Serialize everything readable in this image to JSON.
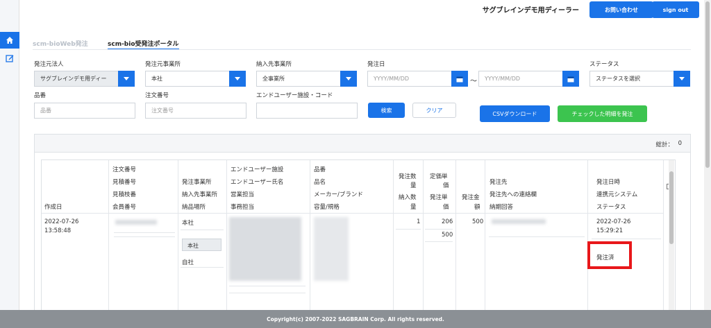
{
  "header": {
    "dealer_name": "サグブレインデモ用ディーラー",
    "contact_label": "お問い合わせ",
    "signout_label": "sign out"
  },
  "sidebar": {
    "items": [
      {
        "icon": "home-icon"
      },
      {
        "icon": "edit-icon"
      }
    ]
  },
  "tabs": [
    {
      "label": "scm-bioWeb発注",
      "active": false
    },
    {
      "label": "scm-bio受発注ポータル",
      "active": true
    }
  ],
  "filters": {
    "ordering_corp_label": "発注元法人",
    "ordering_corp_value": "サグブレインデモ用ディー",
    "ordering_office_label": "発注元事業所",
    "ordering_office_value": "本社",
    "delivery_office_label": "納入先事業所",
    "delivery_office_value": "全事業所",
    "order_date_label": "発注日",
    "date_from_placeholder": "YYYY/MM/DD",
    "date_sep": "〜",
    "date_to_placeholder": "YYYY/MM/DD",
    "status_label": "ステータス",
    "status_value": "ステータスを選択",
    "item_no_label": "品番",
    "item_no_placeholder": "品番",
    "order_no_label": "注文番号",
    "order_no_placeholder": "注文番号",
    "enduser_label": "エンドユーザー施設・コード",
    "enduser_value": ""
  },
  "actions": {
    "search_label": "検索",
    "clear_label": "クリア",
    "csv_label": "CSVダウンロード",
    "order_checked_label": "チェックした明細を発注"
  },
  "results": {
    "total_label": "総計：",
    "total_value": "0",
    "columns": {
      "created": "作成日",
      "col2": [
        "注文番号",
        "見積番号",
        "見積枝番",
        "会員番号"
      ],
      "col3": [
        "発注事業所",
        "納入先事業所",
        "納品場所"
      ],
      "col4": [
        "エンドユーザー施設",
        "エンドユーザー氏名",
        "営業担当",
        "事務担当"
      ],
      "col5": [
        "品番",
        "品名",
        "メーカー/ブランド",
        "容量/規格"
      ],
      "col6": [
        "発注数",
        "量",
        "納入数",
        "量"
      ],
      "col7": [
        "定価単",
        "価",
        "発注単",
        "価"
      ],
      "col8": [
        "発注金",
        "額"
      ],
      "col9": [
        "発注先",
        "発注先への連絡欄",
        "納期回答"
      ],
      "col10": [
        "発注日時",
        "連携元システム",
        "ステータス"
      ]
    },
    "row": {
      "created_date": "2022-07-26",
      "created_time": "13:58:48",
      "office": "本社",
      "delivery_office": "本社",
      "delivery_place": "自社",
      "qty": "1",
      "list_price": "206",
      "unit_price": "500",
      "amount": "500",
      "order_date": "2022-07-26",
      "order_time": "15:29:21",
      "status": "発注済"
    }
  },
  "footer": {
    "copyright": "Copyright(c) 2007-2022 SAGBRAIN Corp. All rights reserved."
  },
  "colors": {
    "primary": "#1a73e8",
    "green": "#3cc44f",
    "highlight": "#e8171a"
  }
}
